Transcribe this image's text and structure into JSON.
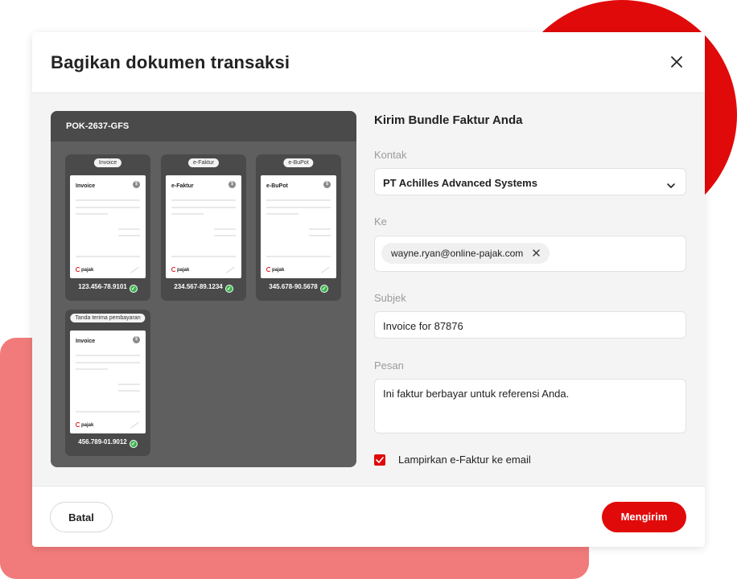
{
  "colors": {
    "accent": "#e10a0a",
    "background_pink": "#f17b7b",
    "success": "#38b54a"
  },
  "modal": {
    "title": "Bagikan dokumen transaksi",
    "close_icon": "close-icon"
  },
  "preview": {
    "bundle_id": "POK-2637-GFS",
    "documents": [
      {
        "label": "Invoice",
        "paper_title": "Invoice",
        "brand": "pajak",
        "number": "123.456-78.9101",
        "status_icon": "check-circle-icon"
      },
      {
        "label": "e-Faktur",
        "paper_title": "e-Faktur",
        "brand": "pajak",
        "number": "234.567-89.1234",
        "status_icon": "check-circle-icon"
      },
      {
        "label": "e-BuPot",
        "paper_title": "e-BuPot",
        "brand": "pajak",
        "number": "345.678-90.5678",
        "status_icon": "check-circle-icon"
      },
      {
        "label": "Tanda terima pembayaran",
        "paper_title": "Invoice",
        "brand": "pajak",
        "number": "456.789-01.9012",
        "status_icon": "check-circle-icon"
      }
    ]
  },
  "form": {
    "title": "Kirim Bundle Faktur Anda",
    "contact": {
      "label": "Kontak",
      "value": "PT Achilles Advanced Systems"
    },
    "to": {
      "label": "Ke",
      "chips": [
        "wayne.ryan@online-pajak.com"
      ]
    },
    "subject": {
      "label": "Subjek",
      "value": "Invoice for 87876"
    },
    "message": {
      "label": "Pesan",
      "value": "Ini faktur berbayar untuk referensi Anda."
    },
    "attach": {
      "label": "Lampirkan e-Faktur ke email",
      "checked": true
    }
  },
  "footer": {
    "cancel_label": "Batal",
    "send_label": "Mengirim"
  }
}
